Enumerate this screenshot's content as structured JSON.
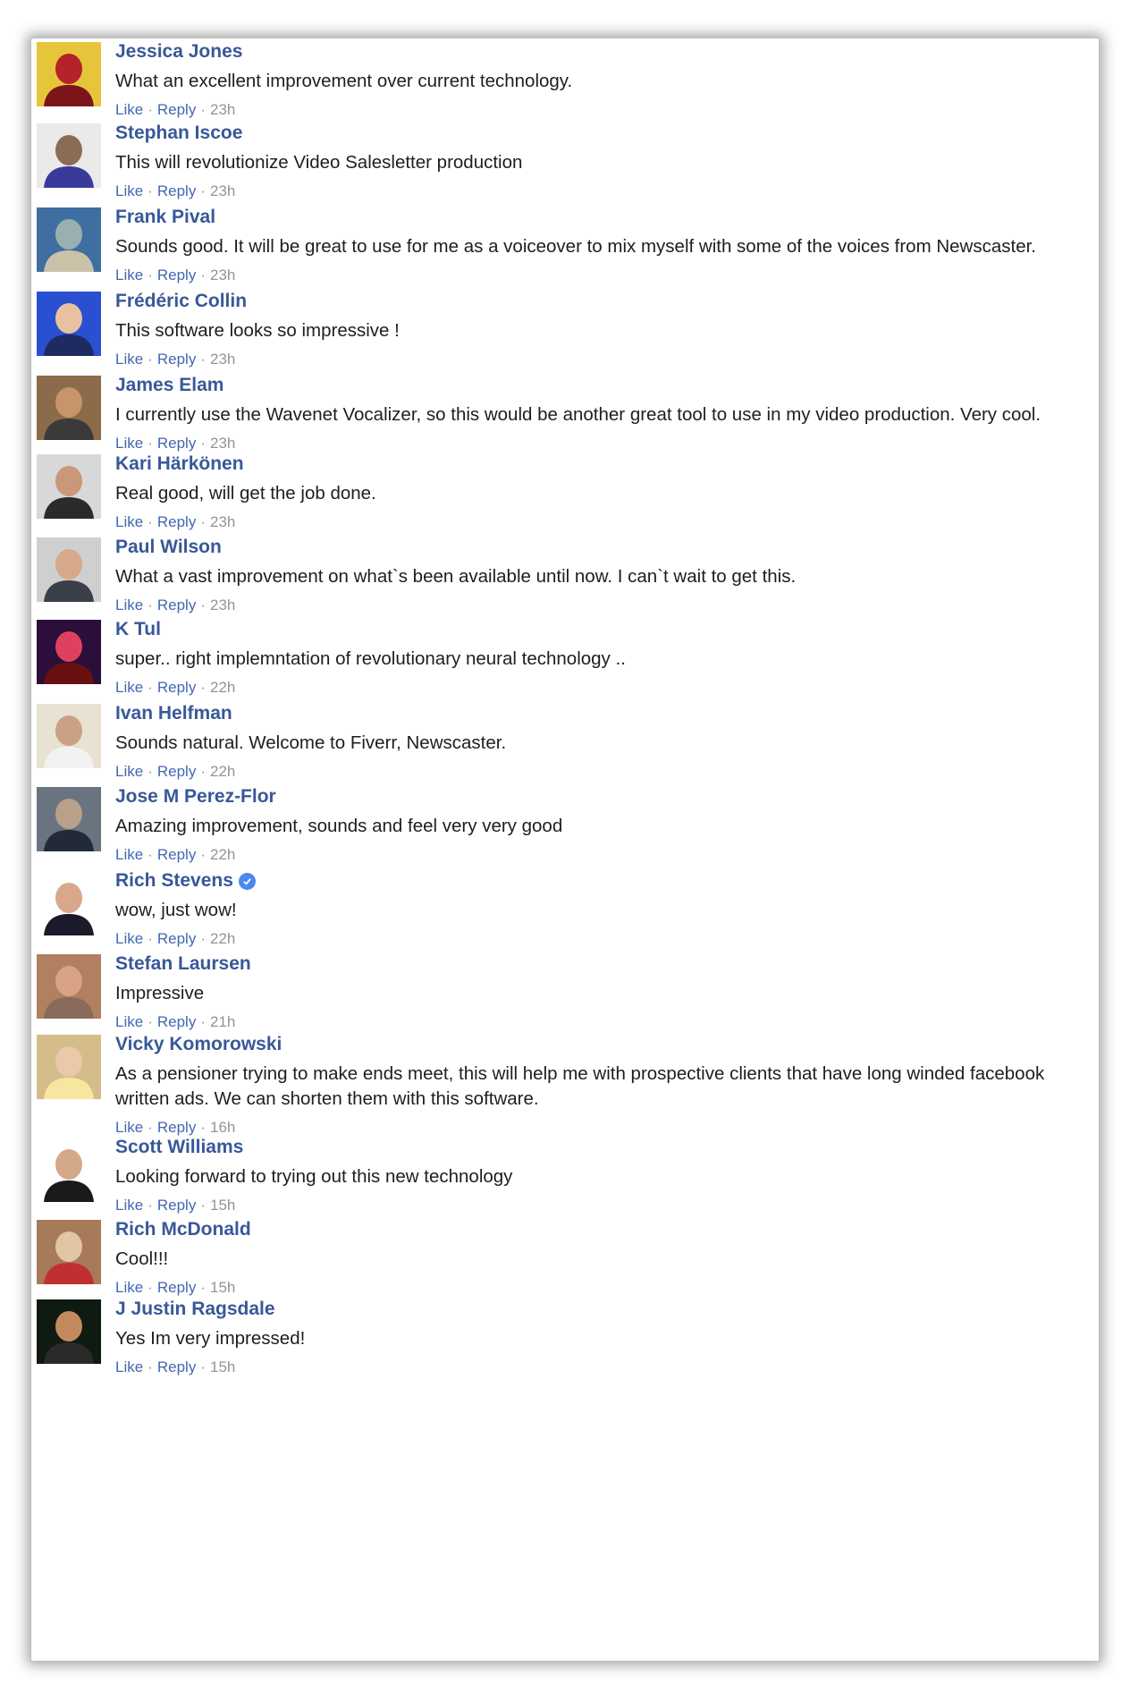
{
  "actions": {
    "like": "Like",
    "reply": "Reply",
    "sep": "·"
  },
  "comments": [
    {
      "name": "Jessica Jones",
      "text": "What an excellent improvement over current technology.",
      "time": "23h",
      "avatar": "avatar-tshirt",
      "verified": false
    },
    {
      "name": "Stephan Iscoe",
      "text": "This will revolutionize Video Salesletter production",
      "time": "23h",
      "avatar": "avatar-man-sunglasses",
      "verified": false
    },
    {
      "name": "Frank Pival",
      "text": "Sounds good. It will be great to use for me as a voiceover to mix myself with some of the voices from Newscaster.",
      "time": "23h",
      "avatar": "avatar-outdoor-truck",
      "verified": false
    },
    {
      "name": "Frédéric Collin",
      "text": "This software looks so impressive !",
      "time": "23h",
      "avatar": "avatar-man-blue-background",
      "verified": false
    },
    {
      "name": "James Elam",
      "text": "I currently use the Wavenet Vocalizer, so this would be another great tool to use in my video production. Very cool.",
      "time": "23h",
      "avatar": "avatar-man-cap",
      "verified": false
    },
    {
      "name": "Kari Härkönen",
      "text": "Real good, will get the job done.",
      "time": "23h",
      "avatar": "avatar-man-shades",
      "verified": false
    },
    {
      "name": "Paul Wilson",
      "text": "What a vast improvement on what`s been available until now. I can`t wait to get this.",
      "time": "23h",
      "avatar": "avatar-man-suit-gray",
      "verified": false
    },
    {
      "name": "K Tul",
      "text": "super.. right implemntation of revolutionary neural technology ..",
      "time": "22h",
      "avatar": "avatar-sunset-tree",
      "verified": false
    },
    {
      "name": "Ivan Helfman",
      "text": "Sounds natural. Welcome to Fiverr, Newscaster.",
      "time": "22h",
      "avatar": "avatar-man-white-cap",
      "verified": false
    },
    {
      "name": "Jose M Perez-Flor",
      "text": "Amazing improvement, sounds and feel very very good",
      "time": "22h",
      "avatar": "avatar-man-office",
      "verified": false
    },
    {
      "name": "Rich Stevens",
      "text": "wow, just wow!",
      "time": "22h",
      "avatar": "avatar-man-suit-tie",
      "verified": true
    },
    {
      "name": "Stefan Laursen",
      "text": "Impressive",
      "time": "21h",
      "avatar": "avatar-man-bald",
      "verified": false
    },
    {
      "name": "Vicky Komorowski",
      "text": "As a pensioner trying to make ends meet, this will help me with prospective clients that have long winded facebook written ads. We can shorten them with this software.",
      "time": "16h",
      "avatar": "avatar-woman-blonde",
      "verified": false
    },
    {
      "name": "Scott Williams",
      "text": "Looking forward to trying out this new technology",
      "time": "15h",
      "avatar": "avatar-man-standing",
      "verified": false
    },
    {
      "name": "Rich McDonald",
      "text": "Cool!!!",
      "time": "15h",
      "avatar": "avatar-room-scene",
      "verified": false
    },
    {
      "name": "J Justin Ragsdale",
      "text": "Yes Im very impressed!",
      "time": "15h",
      "avatar": "avatar-man-smiling",
      "verified": false
    }
  ]
}
